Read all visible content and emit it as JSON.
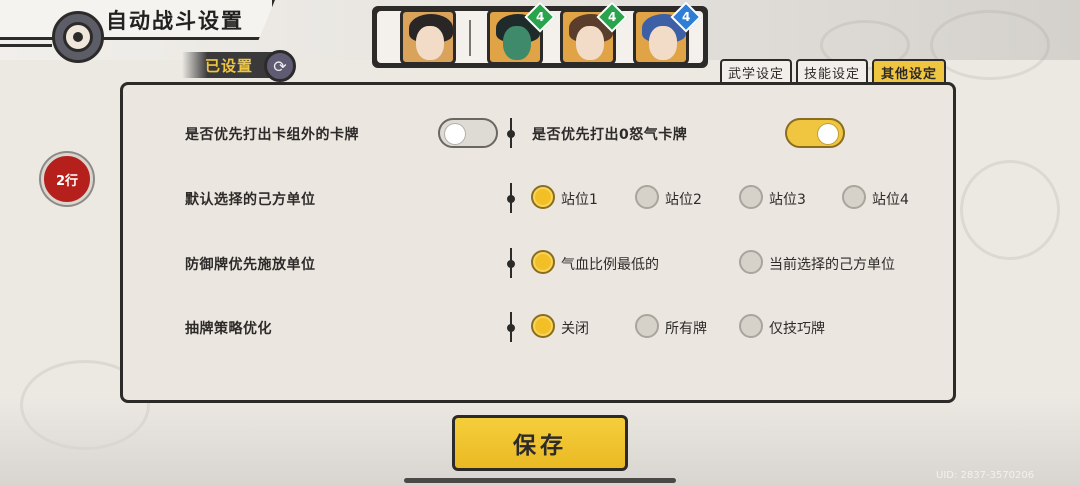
{
  "header": {
    "title": "自动战斗设置",
    "subset_label": "已设置"
  },
  "team": {
    "members": [
      {
        "name": "leader",
        "badge": "",
        "bg": "#d9a35c"
      },
      {
        "name": "member-2",
        "badge": "4",
        "bg": "#e0a346",
        "badge_color": "#2aa34d"
      },
      {
        "name": "member-3",
        "badge": "4",
        "bg": "#e0a346",
        "badge_color": "#2aa34d"
      },
      {
        "name": "member-4",
        "badge": "4",
        "bg": "#e0a346",
        "badge_color": "#2e7ed6"
      }
    ]
  },
  "tabs": [
    {
      "label": "武学设定",
      "active": false
    },
    {
      "label": "技能设定",
      "active": false
    },
    {
      "label": "其他设定",
      "active": true
    }
  ],
  "settings": {
    "row1": {
      "left_label": "是否优先打出卡组外的卡牌",
      "left_toggle": "off",
      "right_label": "是否优先打出0怒气卡牌",
      "right_toggle": "on"
    },
    "row2": {
      "label": "默认选择的己方单位",
      "options": [
        "站位1",
        "站位2",
        "站位3",
        "站位4"
      ],
      "selected": 0
    },
    "row3": {
      "label": "防御牌优先施放单位",
      "options": [
        "气血比例最低的",
        "当前选择的己方单位"
      ],
      "selected": 0
    },
    "row4": {
      "label": "抽牌策略优化",
      "options": [
        "关闭",
        "所有牌",
        "仅技巧牌"
      ],
      "selected": 0
    }
  },
  "side_icon_text": "2行",
  "save_label": "保存",
  "uid": "UID: 2837-3570206",
  "colors": {
    "accent": "#f0c641",
    "dark": "#2d2b2a",
    "panel": "#ebe6df"
  }
}
